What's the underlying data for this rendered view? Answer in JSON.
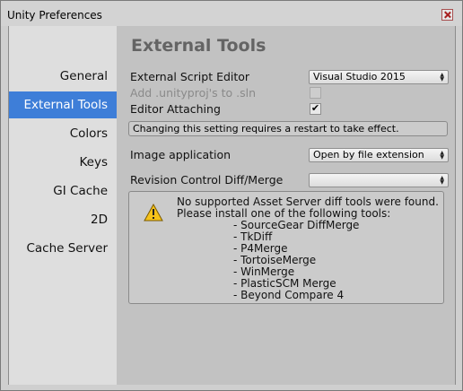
{
  "window": {
    "title": "Unity Preferences"
  },
  "sidebar": {
    "items": [
      {
        "label": "General",
        "active": false
      },
      {
        "label": "External Tools",
        "active": true
      },
      {
        "label": "Colors",
        "active": false
      },
      {
        "label": "Keys",
        "active": false
      },
      {
        "label": "GI Cache",
        "active": false
      },
      {
        "label": "2D",
        "active": false
      },
      {
        "label": "Cache Server",
        "active": false
      }
    ]
  },
  "main": {
    "heading": "External Tools",
    "script_editor": {
      "label": "External Script Editor",
      "value": "Visual Studio 2015"
    },
    "add_unityproj": {
      "label": "Add .unityproj's to .sln",
      "checked": false,
      "enabled": false
    },
    "editor_attaching": {
      "label": "Editor Attaching",
      "checked": true
    },
    "restart_note": "Changing this setting requires a restart to take effect.",
    "image_application": {
      "label": "Image application",
      "value": "Open by file extension"
    },
    "revision_control": {
      "label": "Revision Control Diff/Merge",
      "value": ""
    },
    "diff_help": {
      "line1": "No supported Asset Server diff tools were found.",
      "line2": "Please install one of the following tools:",
      "tools": [
        "- SourceGear DiffMerge",
        "- TkDiff",
        "- P4Merge",
        "- TortoiseMerge",
        "- WinMerge",
        "- PlasticSCM Merge",
        "- Beyond Compare 4"
      ]
    }
  },
  "colors": {
    "accent": "#3e7ed8",
    "sidebar_bg": "#dedede",
    "main_bg": "#c2c2c2",
    "heading": "#646464"
  }
}
